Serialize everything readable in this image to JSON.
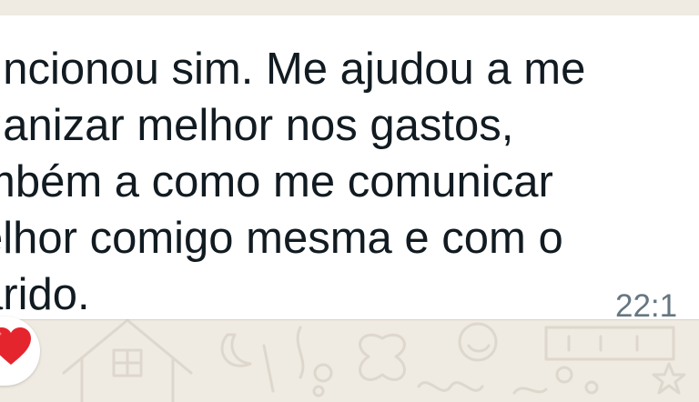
{
  "message": {
    "lines": [
      "uncionou sim. Me ajudou a me",
      "ganizar melhor nos gastos,",
      "mbém a como me comunicar",
      "elhor comigo mesma e com o",
      "arido."
    ],
    "time": "22:1",
    "reaction_icon": "red-heart-icon"
  },
  "colors": {
    "wallpaper": "#efeae2",
    "bubble": "#ffffff",
    "text": "#111b21",
    "time": "#667781",
    "heart": "#e5252e"
  }
}
